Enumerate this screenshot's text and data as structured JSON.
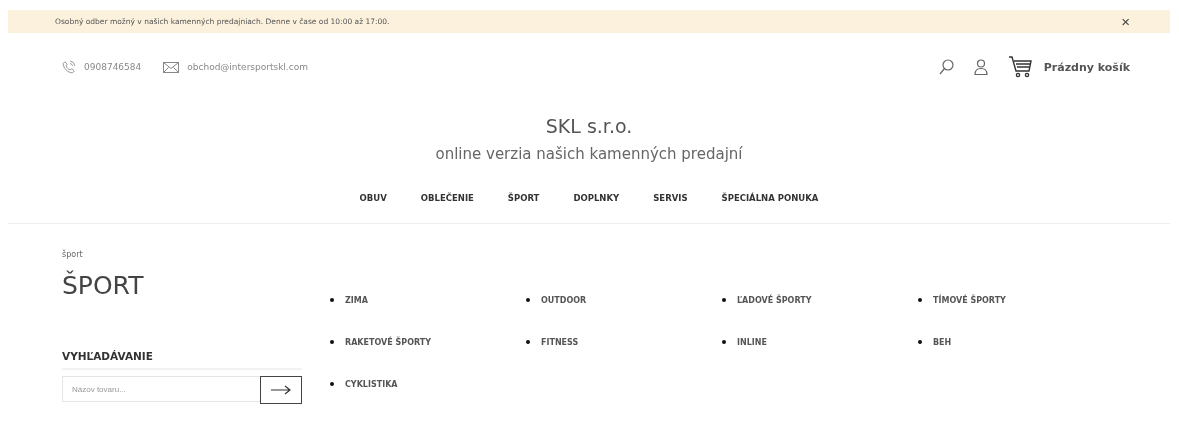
{
  "notice": {
    "text": "Osobný odber možný v našich kamenných predajniach. Denne v čase od 10:00 až 17:00.",
    "close": "×"
  },
  "contact": {
    "phone": "0908746584",
    "email": "obchod@intersportskl.com"
  },
  "cart": {
    "label": "Prázdny košík"
  },
  "brand": {
    "title": "SKL s.r.o.",
    "subtitle": "online verzia našich kamenných predajní"
  },
  "nav": [
    "OBUV",
    "OBLEČENIE",
    "ŠPORT",
    "DOPLNKY",
    "SERVIS",
    "ŠPECIÁLNA PONUKA"
  ],
  "breadcrumb": "šport",
  "heading": "ŠPORT",
  "search": {
    "title": "VYHĽADÁVANIE",
    "placeholder": "Názov tovaru..."
  },
  "categories": [
    "ZIMA",
    "OUTDOOR",
    "ĽADOVÉ ŠPORTY",
    "TÍMOVÉ ŠPORTY",
    "RAKETOVÉ ŠPORTY",
    "FITNESS",
    "INLINE",
    "BEH",
    "CYKLISTIKA"
  ]
}
